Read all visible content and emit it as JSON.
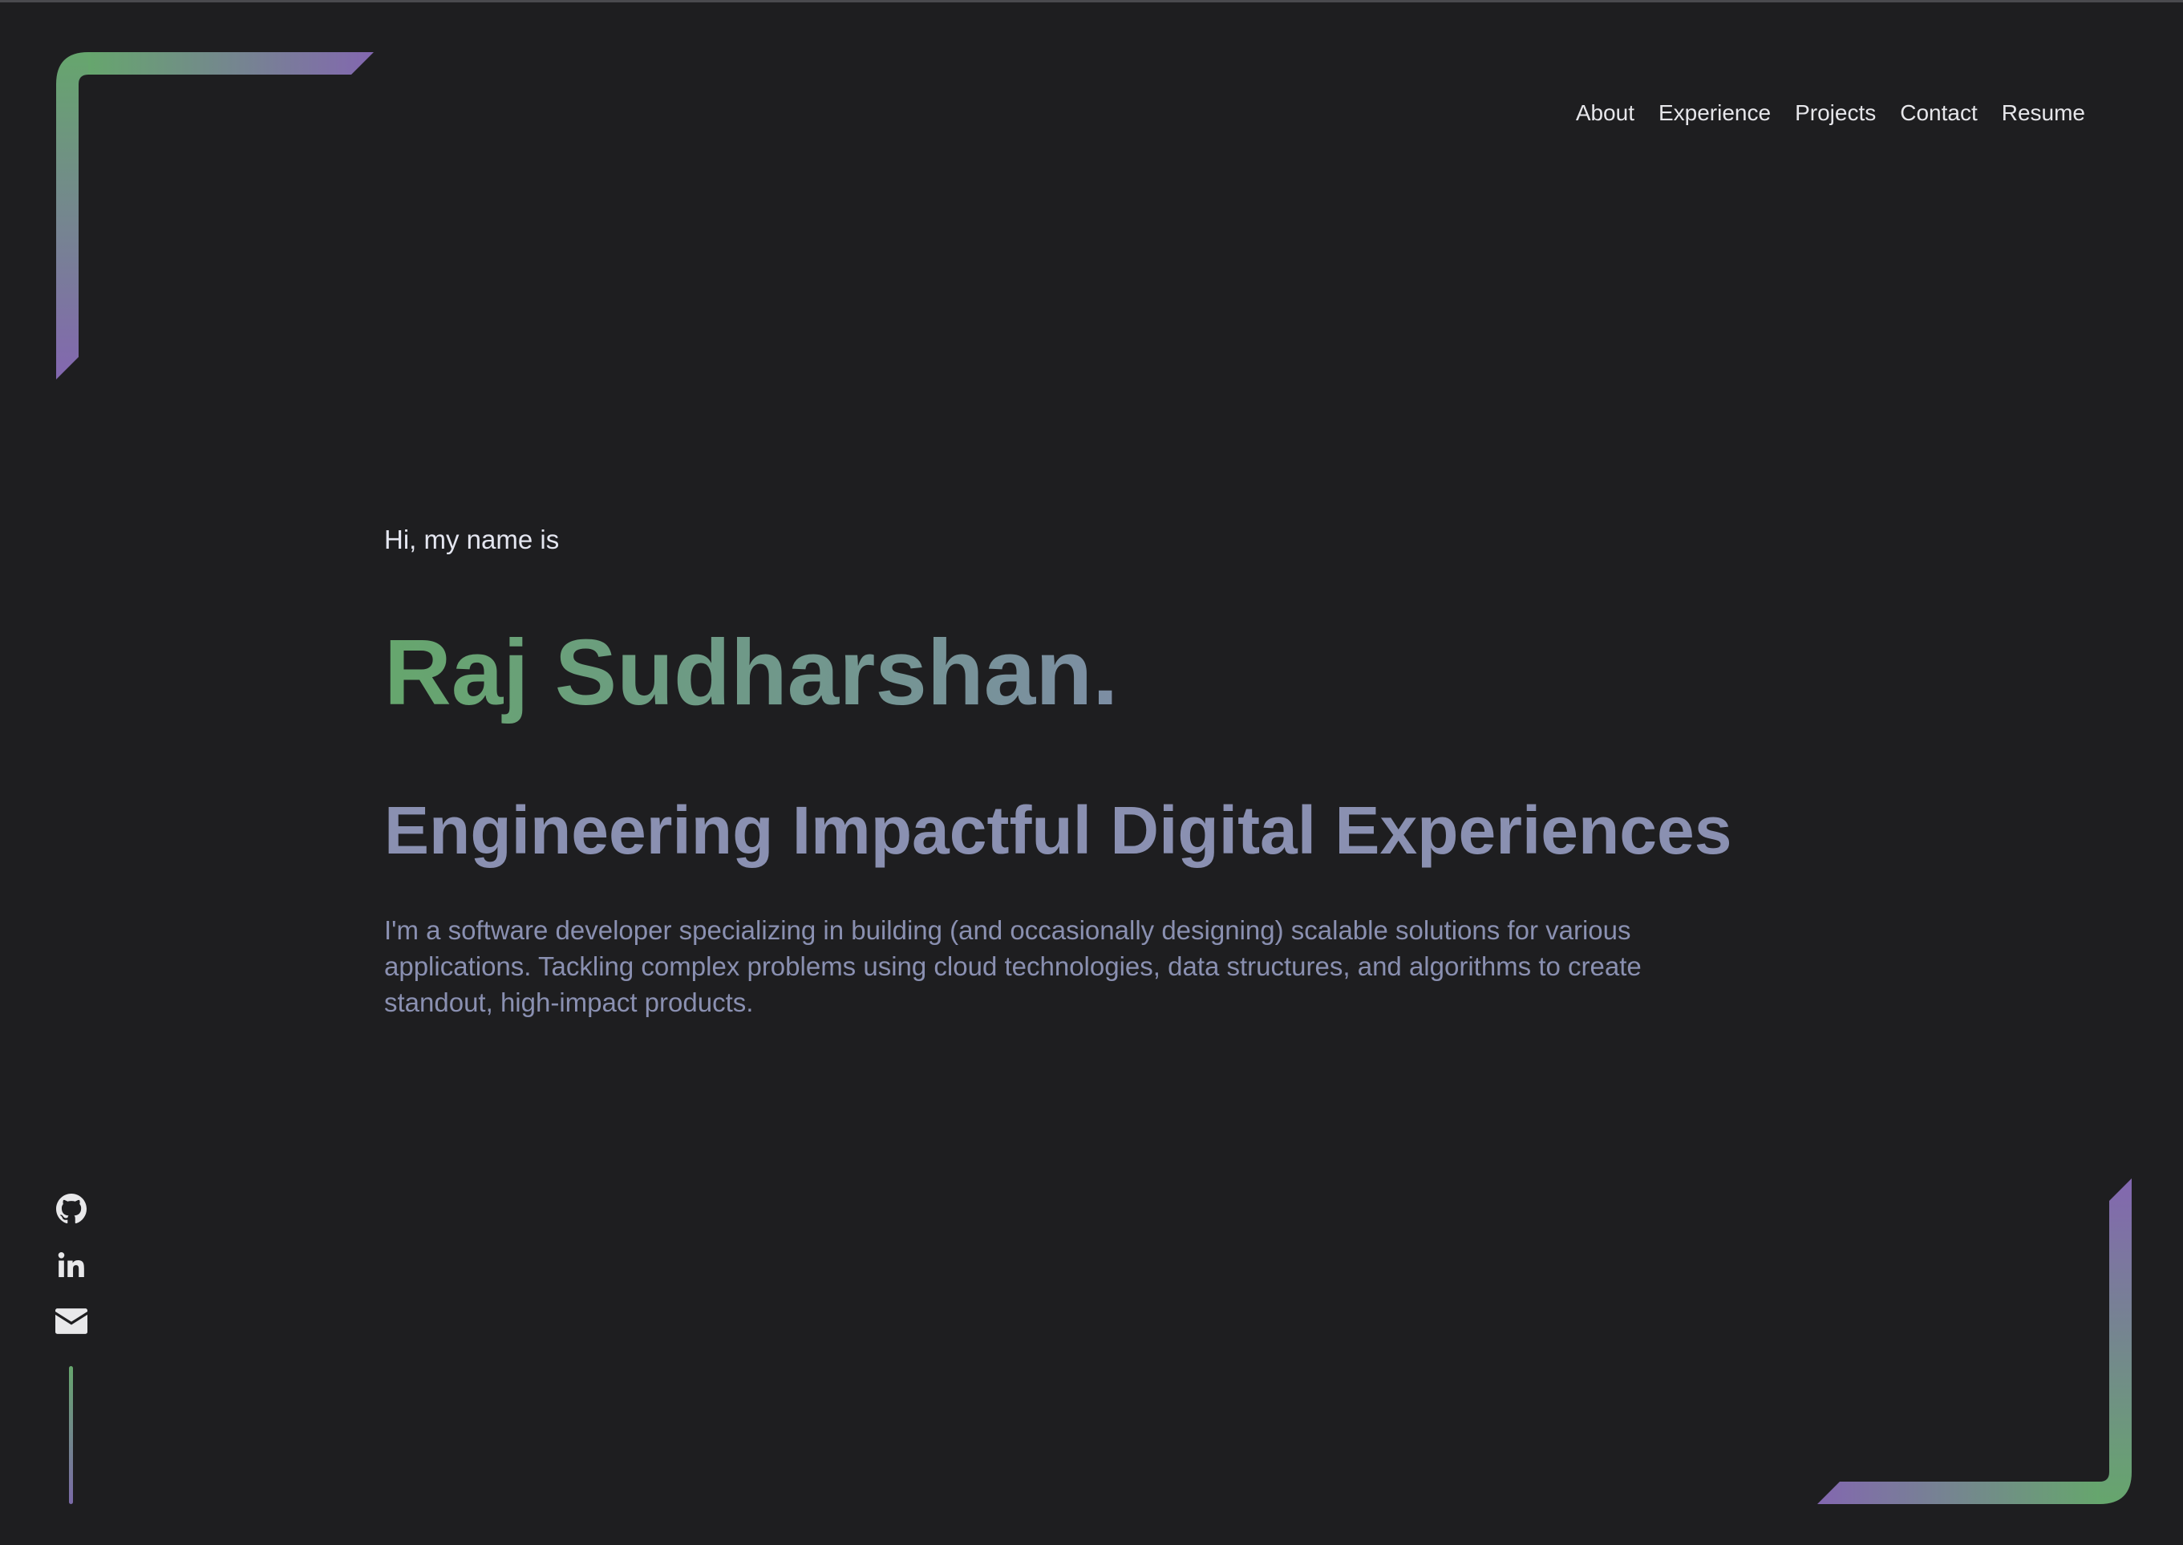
{
  "nav": {
    "items": [
      {
        "label": "About"
      },
      {
        "label": "Experience"
      },
      {
        "label": "Projects"
      },
      {
        "label": "Contact"
      },
      {
        "label": "Resume"
      }
    ]
  },
  "hero": {
    "greeting": "Hi, my name is",
    "name": "Raj Sudharshan.",
    "tagline": "Engineering Impactful Digital Experiences",
    "bio": "I'm a software developer specializing in building (and occasionally designing) scalable solutions for various applications. Tackling complex problems using cloud technologies, data structures, and algorithms to create standout, high-impact products."
  },
  "social": {
    "icons": [
      "github-icon",
      "linkedin-icon",
      "mail-icon"
    ]
  },
  "colors": {
    "background": "#1e1e20",
    "accent_green": "#66a66d",
    "accent_purple": "#7b6aa8",
    "text_muted": "#8a90b1",
    "text_light": "#e6e6ea"
  }
}
